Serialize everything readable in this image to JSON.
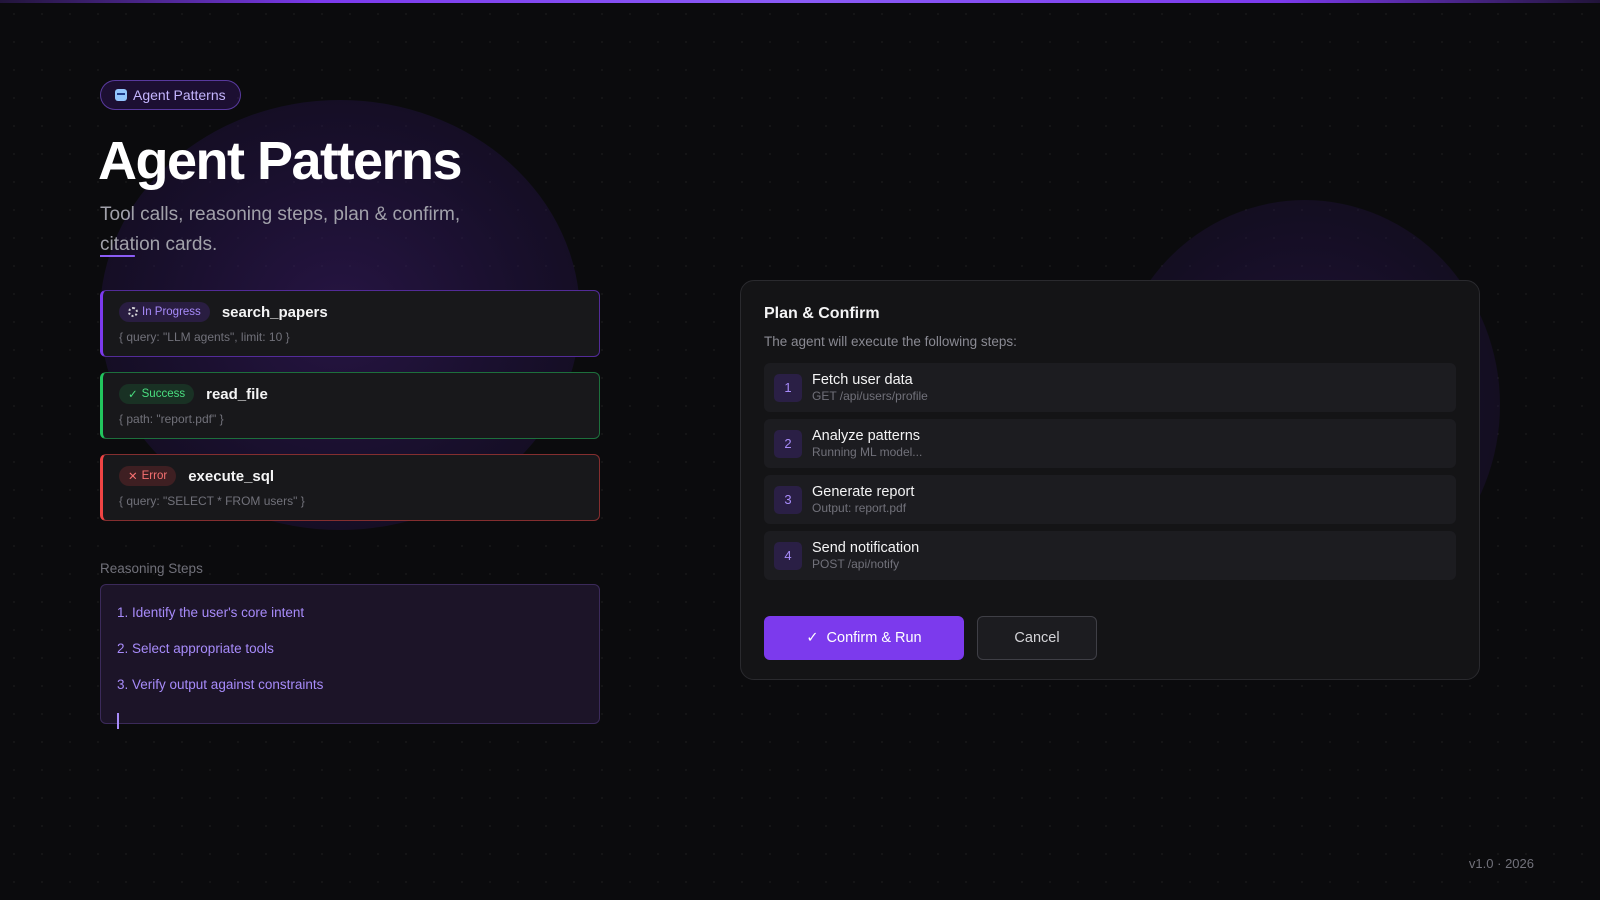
{
  "header": {
    "pill_label": "Agent Patterns",
    "title": "Agent Patterns",
    "subtitle_part1": "Tool calls, reasoning steps, plan & confirm, ",
    "subtitle_underlined": "citat",
    "subtitle_part2": "ion cards."
  },
  "tool_calls": [
    {
      "status": "In Progress",
      "name": "search_papers",
      "args": "{ query: \"LLM agents\", limit: 10 }"
    },
    {
      "status": "Success",
      "name": "read_file",
      "args": "{ path: \"report.pdf\" }"
    },
    {
      "status": "Error",
      "name": "execute_sql",
      "args": "{ query: \"SELECT * FROM users\" }"
    }
  ],
  "reasoning": {
    "label": "Reasoning Steps",
    "items": [
      "1. Identify the user's core intent",
      "2. Select appropriate tools",
      "3. Verify output against constraints"
    ]
  },
  "plan": {
    "title": "Plan & Confirm",
    "description": "The agent will execute the following steps:",
    "steps": [
      {
        "num": "1",
        "title": "Fetch user data",
        "sub": "GET /api/users/profile"
      },
      {
        "num": "2",
        "title": "Analyze patterns",
        "sub": "Running ML model..."
      },
      {
        "num": "3",
        "title": "Generate report",
        "sub": "Output: report.pdf"
      },
      {
        "num": "4",
        "title": "Send notification",
        "sub": "POST /api/notify"
      }
    ],
    "confirm_label": "Confirm & Run",
    "cancel_label": "Cancel"
  },
  "footer": {
    "version": "v1.0",
    "separator": "·",
    "year": "2026"
  },
  "colors": {
    "accent": "#7c3aed",
    "success": "#22c55e",
    "error": "#ef4444"
  }
}
